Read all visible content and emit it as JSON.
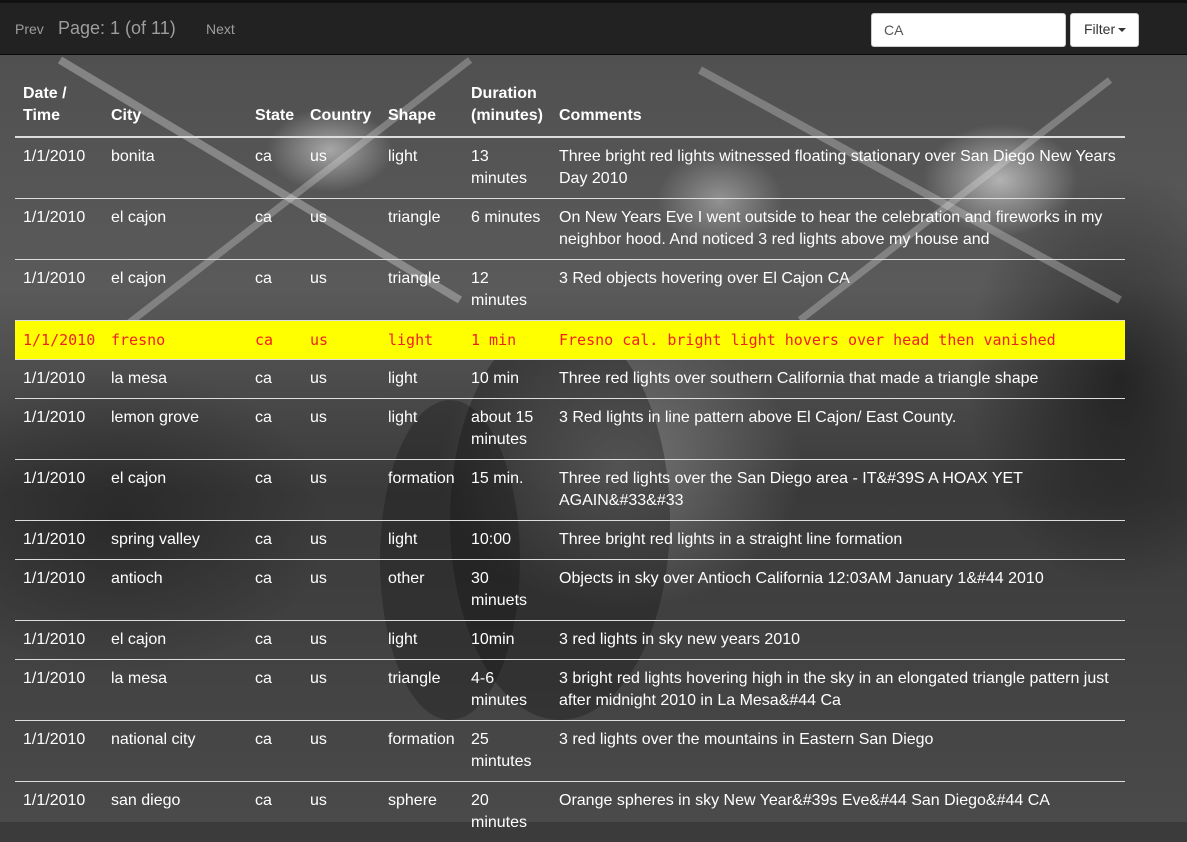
{
  "toolbar": {
    "prev_label": "Prev",
    "page_label": "Page: 1 (of 11)",
    "next_label": "Next",
    "search_value": "CA",
    "filter_label": "Filter"
  },
  "table": {
    "headers": {
      "date_line1": "Date /",
      "date_line2": "Time",
      "city": "City",
      "state": "State",
      "country": "Country",
      "shape": "Shape",
      "duration_line1": "Duration",
      "duration_line2": "(minutes)",
      "comments": "Comments"
    },
    "rows": [
      {
        "date": "1/1/2010",
        "city": "bonita",
        "state": "ca",
        "country": "us",
        "shape": "light",
        "duration": "13 minutes",
        "comments": "Three bright red lights witnessed floating stationary over San Diego New Years Day 2010"
      },
      {
        "date": "1/1/2010",
        "city": "el cajon",
        "state": "ca",
        "country": "us",
        "shape": "triangle",
        "duration": "6 minutes",
        "comments": "On New Years Eve I went outside to hear the celebration and fireworks in my neighbor hood. And noticed 3 red lights above my house and"
      },
      {
        "date": "1/1/2010",
        "city": "el cajon",
        "state": "ca",
        "country": "us",
        "shape": "triangle",
        "duration": "12 minutes",
        "comments": "3 Red objects hovering over El Cajon CA"
      },
      {
        "date": "1/1/2010",
        "city": "fresno",
        "state": "ca",
        "country": "us",
        "shape": "light",
        "duration": "1 min",
        "comments": "Fresno cal. bright light hovers over head then vanished"
      },
      {
        "date": "1/1/2010",
        "city": "la mesa",
        "state": "ca",
        "country": "us",
        "shape": "light",
        "duration": "10 min",
        "comments": "Three red lights over southern California that made a triangle shape"
      },
      {
        "date": "1/1/2010",
        "city": "lemon grove",
        "state": "ca",
        "country": "us",
        "shape": "light",
        "duration": "about 15 minutes",
        "comments": "3 Red lights in line pattern above El Cajon/ East County."
      },
      {
        "date": "1/1/2010",
        "city": "el cajon",
        "state": "ca",
        "country": "us",
        "shape": "formation",
        "duration": "15 min.",
        "comments": "Three red lights over the San Diego area - IT&#39S A HOAX YET AGAIN&#33&#33"
      },
      {
        "date": "1/1/2010",
        "city": "spring valley",
        "state": "ca",
        "country": "us",
        "shape": "light",
        "duration": "10:00",
        "comments": "Three bright red lights in a straight line formation"
      },
      {
        "date": "1/1/2010",
        "city": "antioch",
        "state": "ca",
        "country": "us",
        "shape": "other",
        "duration": "30 minuets",
        "comments": "Objects in sky over Antioch California 12:03AM January 1&#44 2010"
      },
      {
        "date": "1/1/2010",
        "city": "el cajon",
        "state": "ca",
        "country": "us",
        "shape": "light",
        "duration": "10min",
        "comments": "3 red lights in sky new years 2010"
      },
      {
        "date": "1/1/2010",
        "city": "la mesa",
        "state": "ca",
        "country": "us",
        "shape": "triangle",
        "duration": "4-6 minutes",
        "comments": "3 bright red lights hovering high in the sky in an elongated triangle pattern just after midnight 2010 in La Mesa&#44 Ca"
      },
      {
        "date": "1/1/2010",
        "city": "national city",
        "state": "ca",
        "country": "us",
        "shape": "formation",
        "duration": "25 mintutes",
        "comments": "3 red lights over the mountains in Eastern San Diego"
      },
      {
        "date": "1/1/2010",
        "city": "san diego",
        "state": "ca",
        "country": "us",
        "shape": "sphere",
        "duration": "20 minutes",
        "comments": "Orange spheres in sky New Year&#39s Eve&#44 San Diego&#44 CA"
      }
    ],
    "highlight_row_index": 3
  },
  "colors": {
    "highlight_background": "#ffff00",
    "highlight_text": "#f02020",
    "topbar_background": "#222222"
  }
}
